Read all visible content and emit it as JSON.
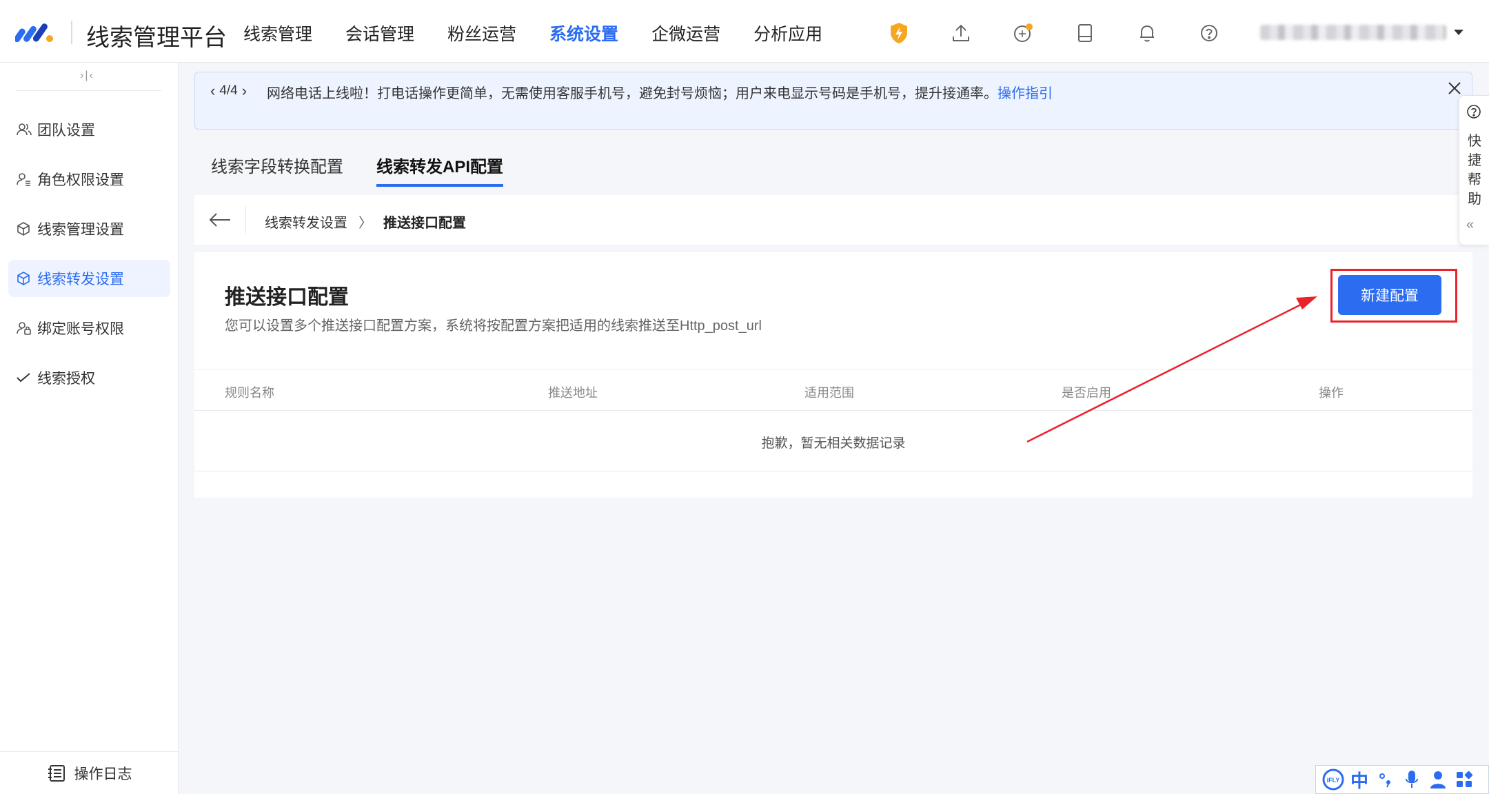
{
  "app": {
    "title": "线索管理平台"
  },
  "topnav": [
    {
      "label": "线索管理",
      "active": false
    },
    {
      "label": "会话管理",
      "active": false
    },
    {
      "label": "粉丝运营",
      "active": false
    },
    {
      "label": "系统设置",
      "active": true
    },
    {
      "label": "企微运营",
      "active": false
    },
    {
      "label": "分析应用",
      "active": false
    }
  ],
  "top_icons": [
    "shield-bolt-icon",
    "upload-icon",
    "badge-icon",
    "tablet-icon",
    "bell-icon",
    "help-icon"
  ],
  "colors": {
    "primary": "#2b6cf0",
    "annotation": "#e8232a",
    "shield": "#f5a623"
  },
  "sidebar": {
    "collapse_label": "›|‹",
    "items": [
      {
        "label": "团队设置",
        "icon": "team-icon",
        "active": false
      },
      {
        "label": "角色权限设置",
        "icon": "role-icon",
        "active": false
      },
      {
        "label": "线索管理设置",
        "icon": "cube-icon",
        "active": false
      },
      {
        "label": "线索转发设置",
        "icon": "cube-icon",
        "active": true
      },
      {
        "label": "绑定账号权限",
        "icon": "account-lock-icon",
        "active": false
      },
      {
        "label": "线索授权",
        "icon": "check-icon",
        "active": false
      }
    ],
    "footer_label": "操作日志"
  },
  "notice": {
    "pager": "4/4",
    "text": "网络电话上线啦！打电话操作更简单，无需使用客服手机号，避免封号烦恼；用户来电显示号码是手机号，提升接通率。",
    "link": "操作指引"
  },
  "tabs": [
    {
      "label": "线索字段转换配置",
      "active": false
    },
    {
      "label": "线索转发API配置",
      "active": true
    }
  ],
  "breadcrumb": {
    "parent": "线索转发设置",
    "separator": "〉",
    "current": "推送接口配置"
  },
  "card": {
    "title": "推送接口配置",
    "description": "您可以设置多个推送接口配置方案，系统将按配置方案把适用的线索推送至Http_post_url",
    "new_button": "新建配置"
  },
  "table": {
    "columns": [
      "规则名称",
      "推送地址",
      "适用范围",
      "是否启用",
      "操作"
    ],
    "empty_text": "抱歉，暂无相关数据记录"
  },
  "help": {
    "text": "快捷帮助",
    "collapse": "«"
  },
  "ime": {
    "items": [
      "iFLY",
      "中",
      "°,",
      "mic",
      "user",
      "grid"
    ],
    "lang": "中"
  }
}
